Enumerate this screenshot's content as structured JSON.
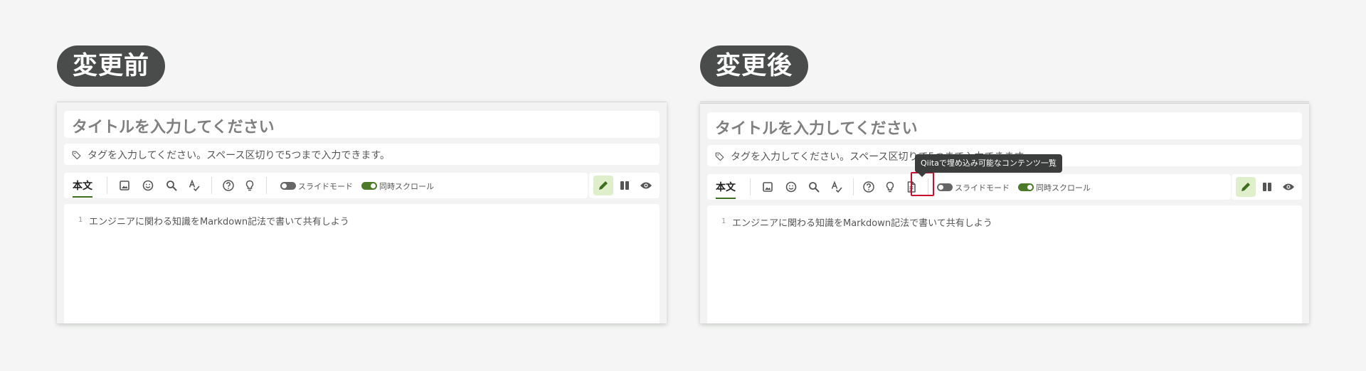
{
  "panels": {
    "before": {
      "badge": "変更前",
      "title_placeholder": "タイトルを入力してください",
      "tag_placeholder": "タグを入力してください。スペース区切りで5つまで入力できます。",
      "tab_label": "本文",
      "slide_mode_label": "スライドモード",
      "sync_scroll_label": "同時スクロール",
      "line_number": "1",
      "body_text": "エンジニアに関わる知識をMarkdown記法で書いて共有しよう"
    },
    "after": {
      "badge": "変更後",
      "title_placeholder": "タイトルを入力してください",
      "tag_placeholder": "タグを入力してください。スペース区切りで5つまで入力できます。",
      "tab_label": "本文",
      "slide_mode_label": "スライドモード",
      "sync_scroll_label": "同時スクロール",
      "line_number": "1",
      "body_text": "エンジニアに関わる知識をMarkdown記法で書いて共有しよう",
      "tooltip": "Qiitaで埋め込み可能なコンテンツ一覧"
    }
  },
  "icons": {
    "tag": "tag-icon",
    "image": "image-icon",
    "emoji": "emoji-icon",
    "search": "search-icon",
    "spellcheck": "spellcheck-icon",
    "help": "help-icon",
    "tips": "lightbulb-icon",
    "embed_list": "document-icon",
    "edit": "pencil-icon",
    "split": "columns-icon",
    "preview": "eye-icon"
  },
  "colors": {
    "accent_green": "#3e6e1f",
    "toggle_on": "#4c7a28",
    "active_view_bg": "#dfeecb",
    "badge_bg": "#4a4c4b",
    "highlight_red": "#c8102e"
  }
}
